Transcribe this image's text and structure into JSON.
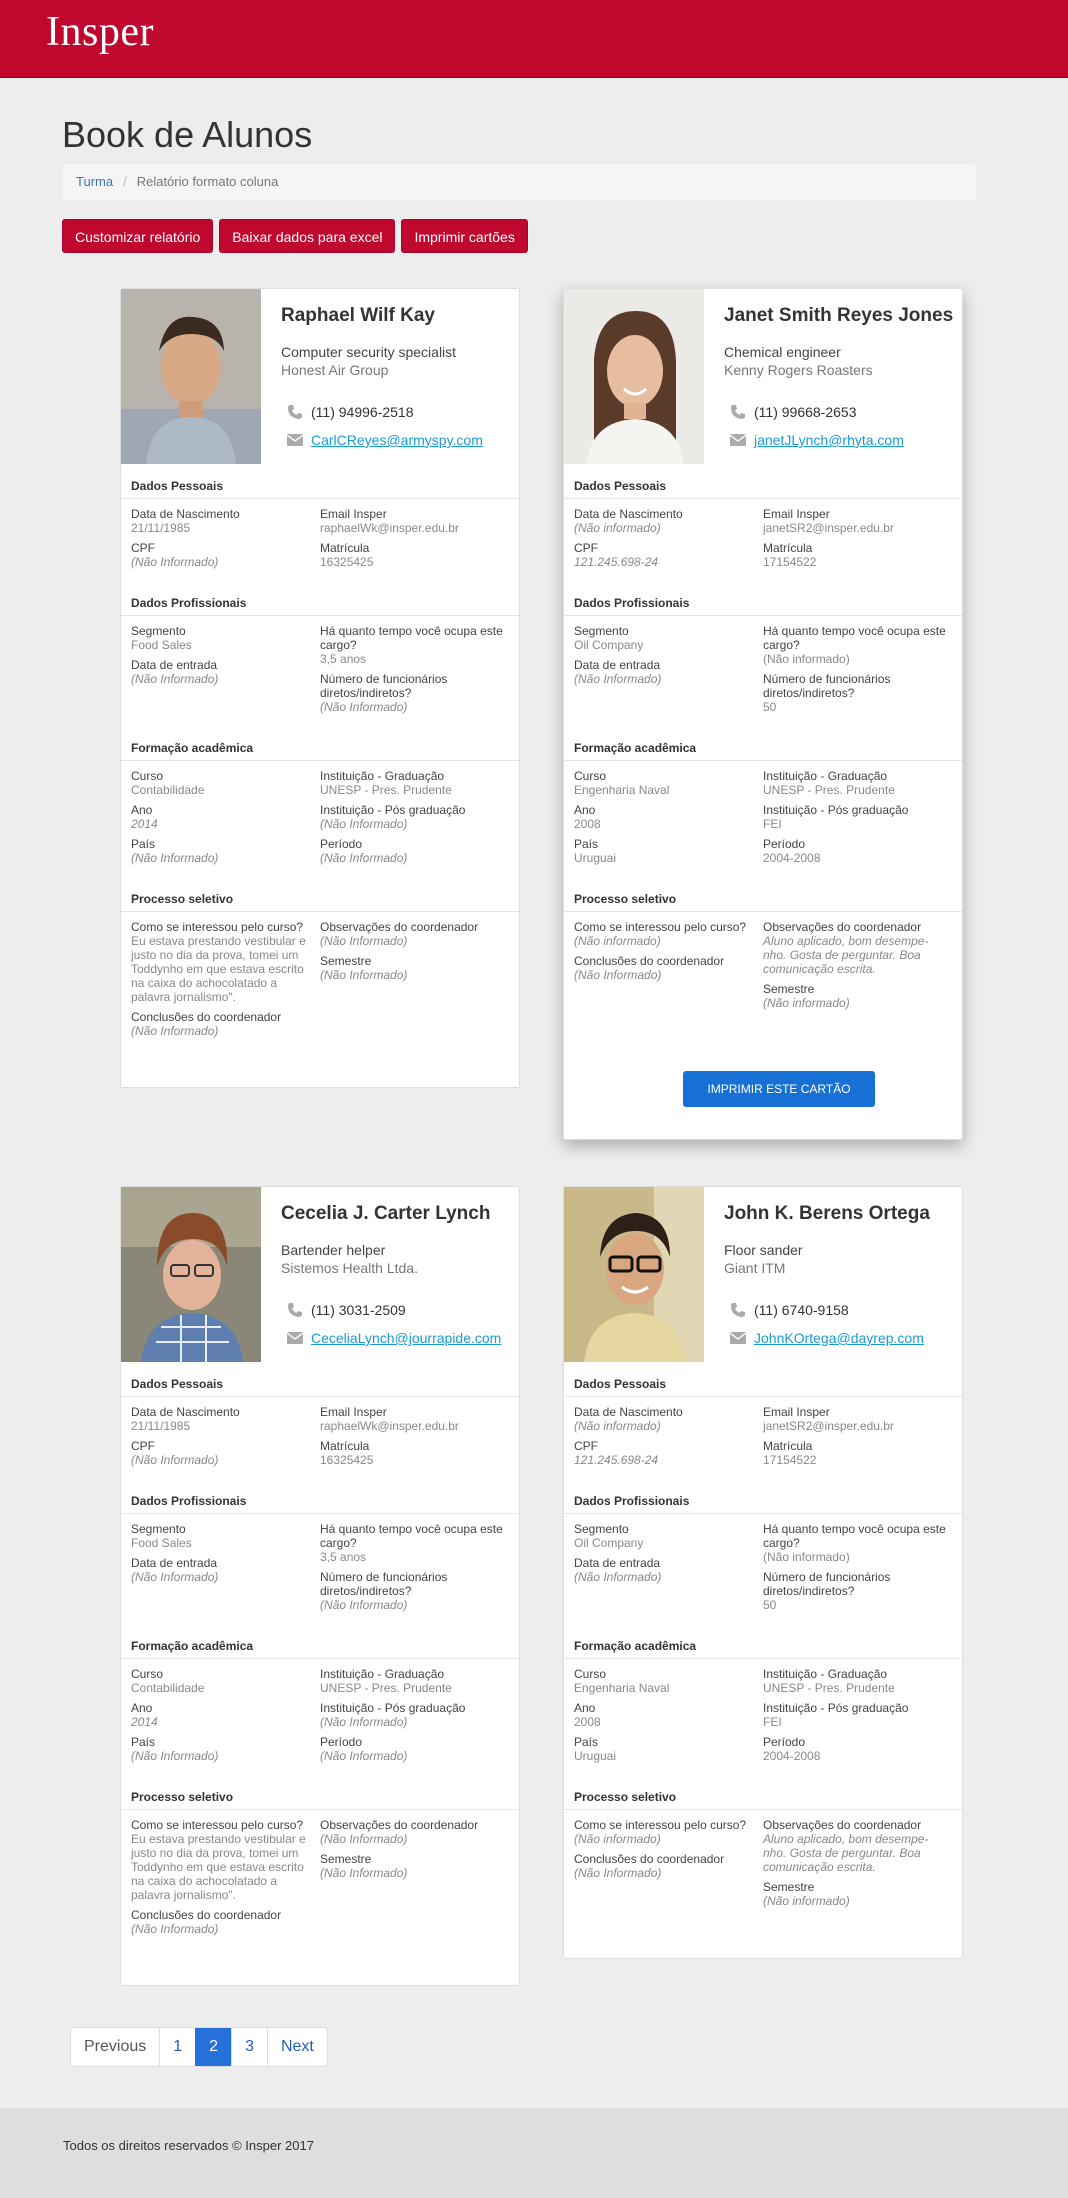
{
  "brand": {
    "logo_text": "Insper",
    "color": "#c0082f"
  },
  "page": {
    "title": "Book de Alunos"
  },
  "breadcrumb": {
    "link": "Turma",
    "current": "Relatório formato coluna"
  },
  "actions": [
    "Customizar relatório",
    "Baixar dados para excel",
    "Imprimir cartões"
  ],
  "section_titles": {
    "pessoais": "Dados Pessoais",
    "profissionais": "Dados Profissionais",
    "formacao": "Formação acadêmica",
    "processo": "Processo seletivo"
  },
  "labels": {
    "nascimento": "Data de Nascimento",
    "email": "Email Insper",
    "cpf": "CPF",
    "matricula": "Matrícula",
    "segmento": "Segmento",
    "tempo": "Há quanto tempo você ocupa este cargo?",
    "entrada": "Data de entrada",
    "funcionarios": "Número de funcionários diretos/indiretos?",
    "curso": "Curso",
    "inst_grad": "Instituição - Graduação",
    "ano": "Ano",
    "inst_pos": "Instituição - Pós graduação",
    "pais": "País",
    "periodo": "Período",
    "interesse": "Como se interessou pelo curso?",
    "obs": "Observações do coordenador",
    "semestre": "Semestre",
    "conclusoes": "Conclusões do coordenador"
  },
  "print_card_label": "IMPRIMIR ESTE CARTÃO",
  "students": [
    {
      "name": "Raphael Wilf Kay",
      "job": "Computer security specialist",
      "company": "Honest Air Group",
      "phone": "(11) 94996-2518",
      "email": "CarlCReyes@armyspy.com",
      "nascimento": "21/11/1985",
      "email_insper": "raphaelWk@insper.edu.br",
      "cpf": "(Não Informado)",
      "matricula": "16325425",
      "segmento": "Food Sales",
      "tempo": "3,5 anos",
      "entrada": "(Não Informado)",
      "funcionarios": "(Não Informado)",
      "curso": "Contabilidade",
      "inst_grad": "UNESP - Pres. Prudente",
      "ano": "2014",
      "inst_pos": "(Não Informado)",
      "pais": "(Não Informado)",
      "periodo": "(Não Informado)",
      "interesse": "Eu estava prestando vestibular e justo no dia da prova, tomei um Toddynho em que estava escrito na caixa do achocolatado a palavra jornalismo\".",
      "obs": "(Não Informado)",
      "semestre": "(Não Informado)",
      "conclusoes": "(Não Informado)"
    },
    {
      "name": "Janet Smith Reyes Jones",
      "job": "Chemical engineer",
      "company": "Kenny Rogers Roasters",
      "phone": "(11)  99668-2653",
      "email": "janetJLynch@rhyta.com",
      "nascimento": "(Não informado)",
      "email_insper": "janetSR2@insper.edu.br",
      "cpf": "121.245.698-24",
      "matricula": "17154522",
      "segmento": "Oil Company",
      "tempo": "(Não informado)",
      "entrada": "(Não Informado)",
      "funcionarios": "50",
      "curso": "Engenharia Naval",
      "inst_grad": "UNESP - Pres. Prudente",
      "ano": "2008",
      "inst_pos": "FEI",
      "pais": "Uruguai",
      "periodo": "2004-2008",
      "interesse": "(Não informado)",
      "obs": "Aluno aplicado, bom desempe-nho. Gosta de perguntar. Boa comunicação escrita.",
      "semestre": "(Não informado)",
      "conclusoes": "(Não Informado)"
    },
    {
      "name": "Cecelia J. Carter Lynch",
      "job": "Bartender helper",
      "company": "Sistemos Health Ltda.",
      "phone": "(11) 3031-2509",
      "email": "CeceliaLynch@jourrapide.com",
      "nascimento": "21/11/1985",
      "email_insper": "raphaelWk@insper.edu.br",
      "cpf": "(Não Informado)",
      "matricula": "16325425",
      "segmento": "Food Sales",
      "tempo": "3,5 anos",
      "entrada": "(Não Informado)",
      "funcionarios": "(Não Informado)",
      "curso": "Contabilidade",
      "inst_grad": "UNESP - Pres. Prudente",
      "ano": "2014",
      "inst_pos": "(Não Informado)",
      "pais": "(Não Informado)",
      "periodo": "(Não Informado)",
      "interesse": "Eu estava prestando vestibular e justo no dia da prova, tomei um Toddynho em que estava escrito na caixa do achocolatado a palavra jornalismo\".",
      "obs": "(Não Informado)",
      "semestre": "(Não Informado)",
      "conclusoes": "(Não Informado)"
    },
    {
      "name": "John K. Berens Ortega",
      "job": "Floor sander",
      "company": "Giant ITM",
      "phone": "(11) 6740-9158",
      "email": "JohnKOrtega@dayrep.com",
      "nascimento": "(Não informado)",
      "email_insper": "janetSR2@insper.edu.br",
      "cpf": "121.245.698-24",
      "matricula": "17154522",
      "segmento": "Oil Company",
      "tempo": "(Não informado)",
      "entrada": "(Não Informado)",
      "funcionarios": "50",
      "curso": "Engenharia Naval",
      "inst_grad": "UNESP - Pres. Prudente",
      "ano": "2008",
      "inst_pos": "FEI",
      "pais": "Uruguai",
      "periodo": "2004-2008",
      "interesse": "(Não informado)",
      "obs": "Aluno aplicado, bom desempe-nho. Gosta de perguntar. Boa comunicação escrita.",
      "semestre": "(Não informado)",
      "conclusoes": "(Não Informado)"
    }
  ],
  "pagination": {
    "previous": "Previous",
    "pages": [
      "1",
      "2",
      "3"
    ],
    "current": "2",
    "next": "Next"
  },
  "footer": {
    "text": "Todos os direitos reservados © Insper 2017"
  }
}
